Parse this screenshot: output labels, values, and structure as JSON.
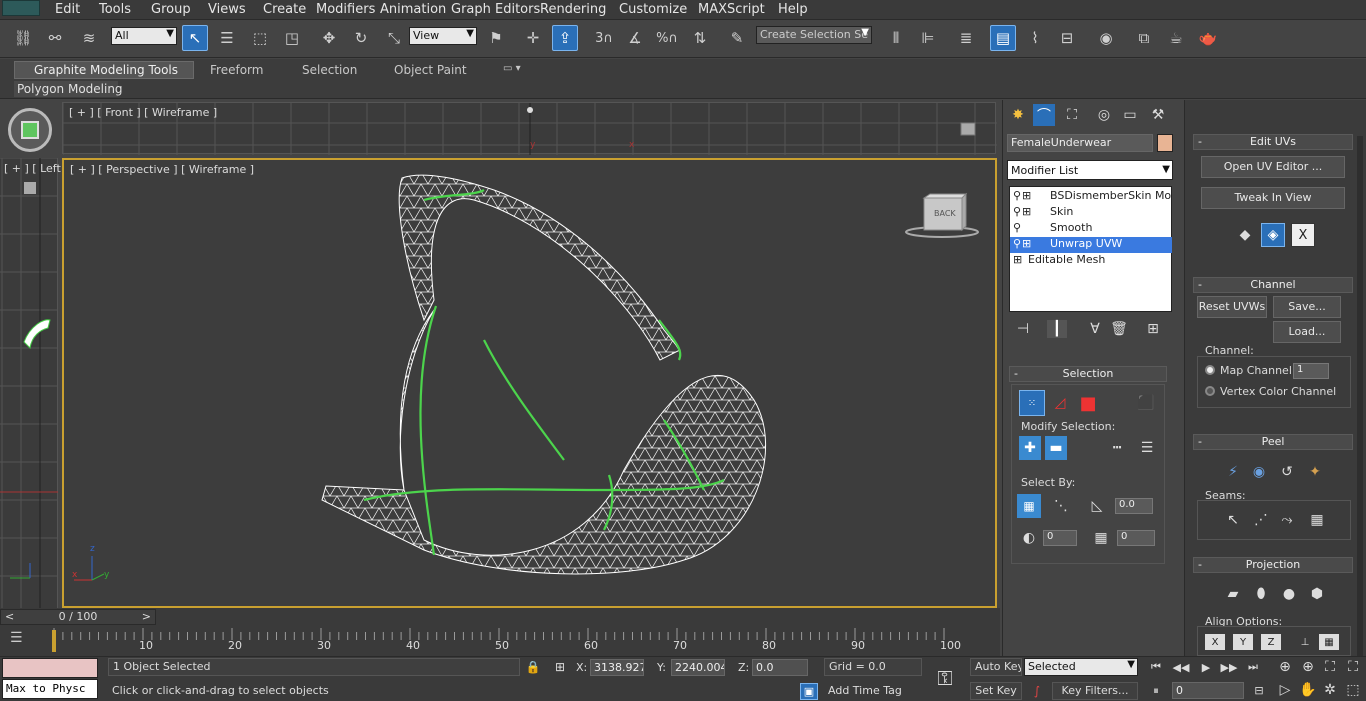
{
  "menubar": {
    "items": [
      "Edit",
      "Tools",
      "Group",
      "Views",
      "Create",
      "Modifiers",
      "Animation",
      "Graph Editors",
      "Rendering",
      "Customize",
      "MAXScript",
      "Help"
    ]
  },
  "toolbar": {
    "filter_dropdown": "All",
    "ref_coord_dropdown": "View",
    "snap_angle_label": "3",
    "named_selection_placeholder": "Create Selection Se"
  },
  "ribbon": {
    "tabs": [
      "Graphite Modeling Tools",
      "Freeform",
      "Selection",
      "Object Paint"
    ],
    "subtab": "Polygon Modeling"
  },
  "viewports": {
    "front_label": "[ + ] [ Front ] [ Wireframe ]",
    "left_label": "[ + ] [ Left",
    "persp_label": "[ + ] [ Perspective ] [ Wireframe ]",
    "viewcube_label": "BACK",
    "axis_x": "x",
    "axis_y": "y",
    "axis_z": "z"
  },
  "timeline": {
    "slider_text": "0 / 100",
    "prev": "<",
    "next": ">",
    "ticks": [
      "0",
      "10",
      "20",
      "30",
      "40",
      "50",
      "60",
      "70",
      "80",
      "90",
      "100"
    ]
  },
  "status": {
    "maxscript_listener": "Max to Physc",
    "selection_info": "1 Object Selected",
    "prompt": "Click or click-and-drag to select objects",
    "x_label": "X:",
    "x_value": "3138.927",
    "y_label": "Y:",
    "y_value": "2240.004",
    "z_label": "Z:",
    "z_value": "0.0",
    "grid": "Grid = 0.0",
    "add_time_tag": "Add Time Tag",
    "auto_key": "Auto Key",
    "set_key": "Set Key",
    "selected_dropdown": "Selected",
    "key_filters": "Key Filters...",
    "frame_value": "0"
  },
  "command_panel": {
    "object_name": "FemaleUnderwear",
    "object_color": "#e8b494",
    "modifier_list": "Modifier List",
    "stack": [
      {
        "label": "BSDismemberSkin Modifie",
        "selected": false
      },
      {
        "label": "Skin",
        "selected": false
      },
      {
        "label": "Smooth",
        "selected": false
      },
      {
        "label": "Unwrap UVW",
        "selected": true
      },
      {
        "label": "Editable Mesh",
        "selected": false
      }
    ],
    "selection_rollout": {
      "title": "Selection",
      "modify_selection": "Modify Selection:",
      "select_by": "Select By:",
      "threshold_value": "0.0",
      "spinner_a": "0",
      "spinner_b": "0"
    }
  },
  "right_panel": {
    "edit_uvs": {
      "title": "Edit UVs",
      "open_editor": "Open UV Editor ...",
      "tweak": "Tweak In View",
      "close_glyph": "X"
    },
    "channel": {
      "title": "Channel",
      "reset": "Reset UVWs",
      "save": "Save...",
      "load": "Load...",
      "channel_label": "Channel:",
      "map_channel_label": "Map Channel:",
      "map_channel_value": "1",
      "vertex_color": "Vertex Color Channel"
    },
    "peel": {
      "title": "Peel",
      "seams": "Seams:"
    },
    "projection": {
      "title": "Projection",
      "align_options": "Align Options:",
      "align_buttons": [
        "X",
        "Y",
        "Z"
      ]
    }
  }
}
